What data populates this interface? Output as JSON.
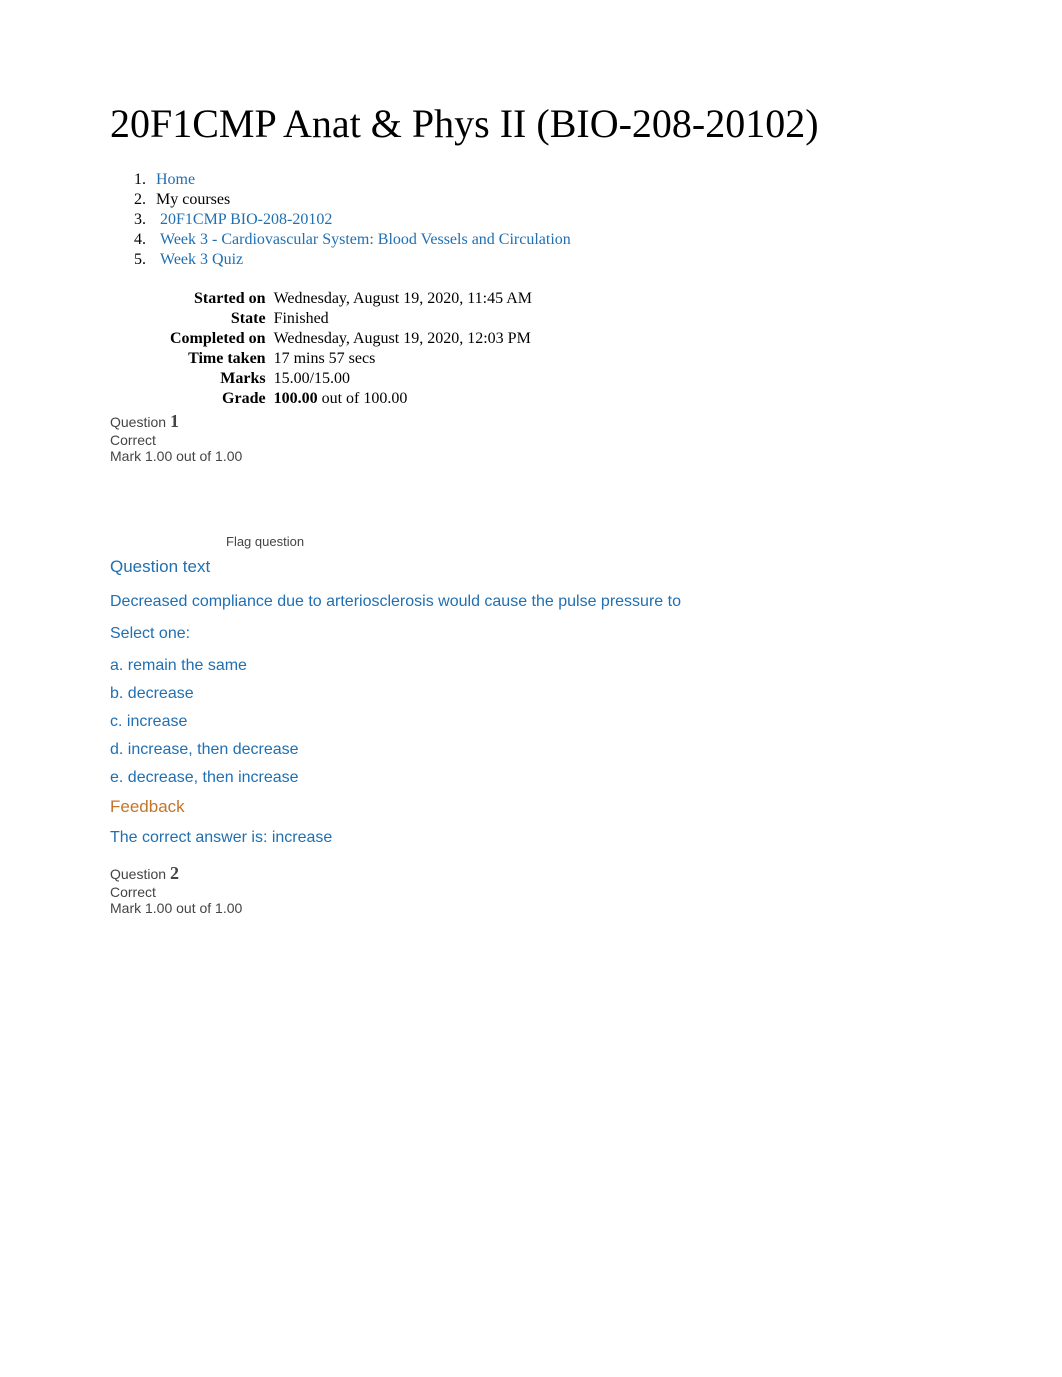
{
  "page_title": "20F1CMP Anat & Phys II (BIO-208-20102)",
  "breadcrumb": [
    {
      "label": "Home",
      "link": true
    },
    {
      "label": "My courses",
      "link": false
    },
    {
      "label": "20F1CMP BIO-208-20102",
      "link": true
    },
    {
      "label": "Week 3 - Cardiovascular System: Blood Vessels and Circulation",
      "link": true
    },
    {
      "label": "Week 3 Quiz",
      "link": true
    }
  ],
  "summary": {
    "started_on_label": "Started on",
    "started_on": "Wednesday, August 19, 2020, 11:45 AM",
    "state_label": "State",
    "state": "Finished",
    "completed_on_label": "Completed on",
    "completed_on": "Wednesday, August 19, 2020, 12:03 PM",
    "time_taken_label": "Time taken",
    "time_taken": "17 mins 57 secs",
    "marks_label": "Marks",
    "marks": "15.00/15.00",
    "grade_label": "Grade",
    "grade_value": "100.00",
    "grade_suffix": " out of 100.00"
  },
  "q1": {
    "question_label": "Question ",
    "number": "1",
    "status": "Correct",
    "mark": "Mark 1.00 out of 1.00",
    "flag": "Flag question",
    "heading": "Question text",
    "text": "Decreased compliance due to arteriosclerosis would cause the pulse pressure to",
    "select_one": "Select one:",
    "options": {
      "a": "a. remain the same",
      "b": "b. decrease",
      "c": "c. increase",
      "d": "d. increase, then decrease",
      "e": "e. decrease, then increase"
    },
    "feedback_heading": "Feedback",
    "feedback_text": "The correct answer is: increase"
  },
  "q2": {
    "question_label": "Question ",
    "number": "2",
    "status": "Correct",
    "mark": "Mark 1.00 out of 1.00"
  }
}
